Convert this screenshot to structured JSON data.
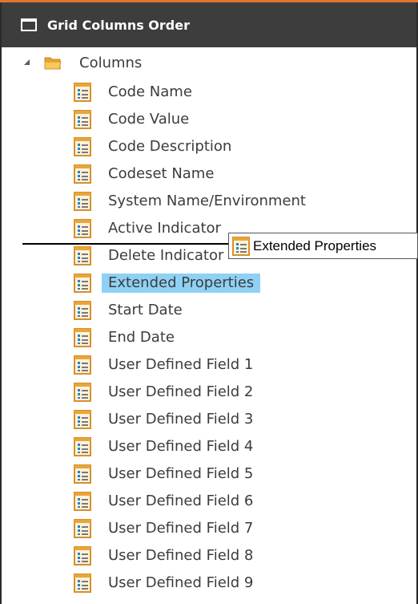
{
  "window": {
    "title": "Grid Columns Order"
  },
  "tree": {
    "root_label": "Columns",
    "root_expanded": true,
    "items": [
      {
        "label": "Code Name"
      },
      {
        "label": "Code Value"
      },
      {
        "label": "Code Description"
      },
      {
        "label": "Codeset Name"
      },
      {
        "label": "System Name/Environment"
      },
      {
        "label": "Active Indicator"
      },
      {
        "label": "Delete Indicator"
      },
      {
        "label": "Extended Properties",
        "selected": true
      },
      {
        "label": "Start Date"
      },
      {
        "label": "End Date"
      },
      {
        "label": "User Defined Field 1"
      },
      {
        "label": "User Defined Field 2"
      },
      {
        "label": "User Defined Field 3"
      },
      {
        "label": "User Defined Field 4"
      },
      {
        "label": "User Defined Field 5"
      },
      {
        "label": "User Defined Field 6"
      },
      {
        "label": "User Defined Field 7"
      },
      {
        "label": "User Defined Field 8"
      },
      {
        "label": "User Defined Field 9"
      }
    ]
  },
  "drag": {
    "label": "Extended Properties"
  },
  "colors": {
    "title_bar": "#3d3d3d",
    "accent": "#e0762d",
    "selection": "#8fd1f5",
    "folder": "#f5b94a",
    "column_icon": "#e8a63a"
  },
  "icons": {
    "title": "window-icon",
    "expander": "expanded-triangle-icon",
    "root": "folder-open-icon",
    "column": "column-field-icon"
  }
}
